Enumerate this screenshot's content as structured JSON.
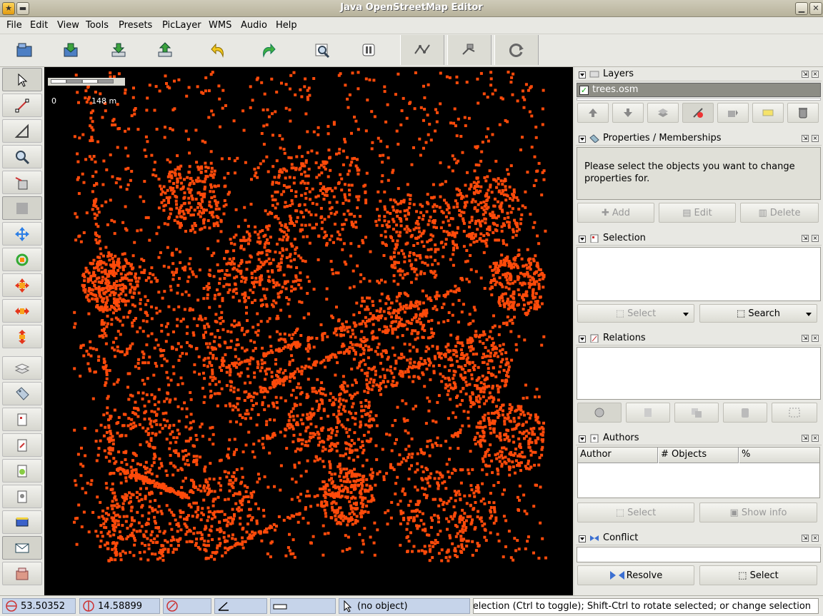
{
  "window": {
    "title": "Java OpenStreetMap Editor"
  },
  "menu": [
    "File",
    "Edit",
    "View",
    "Tools",
    "Presets",
    "PicLayer",
    "WMS",
    "Audio",
    "Help"
  ],
  "toolbar": {
    "buttons": [
      "open-icon",
      "save-icon",
      "download-icon",
      "upload-icon",
      "undo-icon",
      "redo-icon",
      "zoom-preview-icon",
      "preferences-icon",
      "wireframe-icon",
      "way-select-icon",
      "refresh-icon"
    ]
  },
  "left_tools": [
    "select-mode",
    "draw-mode",
    "measure-angle",
    "zoom-mode",
    "delete-mode",
    "empty-tool",
    "move-all",
    "rotate",
    "scale-all",
    "scale-x",
    "scale-y",
    "toggle-layers",
    "toggle-properties",
    "toggle-selection",
    "toggle-relations",
    "toggle-conflict",
    "toggle-authors",
    "toggle-command-stack",
    "toggle-mail",
    "toggle-history"
  ],
  "map": {
    "background": "#000000",
    "node_color": "#ff4a0a",
    "scale": {
      "start": "0",
      "end": "148 m"
    }
  },
  "layers": {
    "title": "Layers",
    "items": [
      {
        "name": "trees.osm",
        "visible": true
      }
    ],
    "buttons": [
      "move-up",
      "move-down",
      "merge",
      "visibility",
      "make-active",
      "info",
      "delete"
    ]
  },
  "properties": {
    "title": "Properties / Memberships",
    "message": "Please select the objects you want to change properties for.",
    "add": "Add",
    "edit": "Edit",
    "delete": "Delete"
  },
  "selection": {
    "title": "Selection",
    "select": "Select",
    "search": "Search"
  },
  "relations": {
    "title": "Relations"
  },
  "authors": {
    "title": "Authors",
    "columns": [
      "Author",
      "# Objects",
      "%"
    ],
    "select": "Select",
    "show_info": "Show info"
  },
  "conflict": {
    "title": "Conflict",
    "resolve": "Resolve",
    "select": "Select"
  },
  "status": {
    "lat": "53.50352",
    "lon": "14.58899",
    "object": "(no object)",
    "help": "selection (Ctrl to toggle); Shift-Ctrl to rotate selected; or change selection"
  }
}
